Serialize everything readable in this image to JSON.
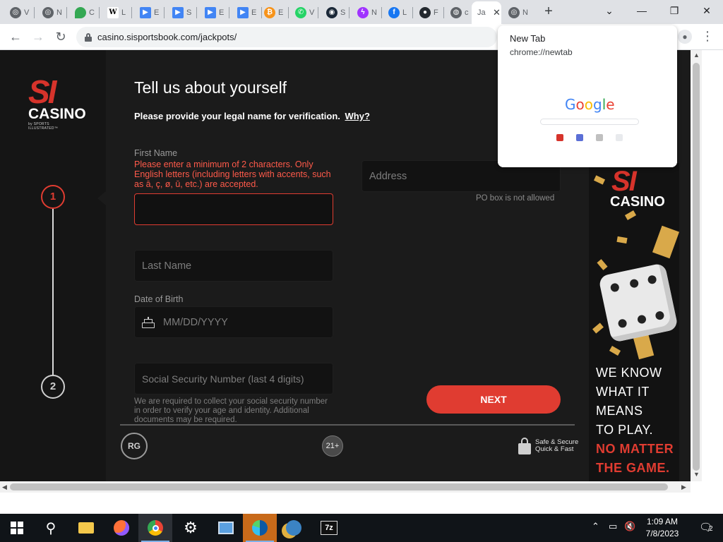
{
  "browser": {
    "tabs": [
      {
        "label": "V",
        "icon": "chrome-icon",
        "color": "#5f6368"
      },
      {
        "label": "N",
        "icon": "chrome-icon",
        "color": "#5f6368"
      },
      {
        "label": "C",
        "icon": "google-maps-icon",
        "color": "#34a853"
      },
      {
        "label": "L",
        "icon": "wikipedia-icon",
        "color": "#202124"
      },
      {
        "label": "E",
        "icon": "play-icon",
        "color": "#4285f4"
      },
      {
        "label": "S",
        "icon": "play-icon",
        "color": "#4285f4"
      },
      {
        "label": "E",
        "icon": "play-icon",
        "color": "#4285f4"
      },
      {
        "label": "E",
        "icon": "play-icon",
        "color": "#4285f4"
      },
      {
        "label": "E",
        "icon": "bitcoin-icon",
        "color": "#f7931a"
      },
      {
        "label": "V",
        "icon": "whatsapp-icon",
        "color": "#25d366"
      },
      {
        "label": "S",
        "icon": "steam-icon",
        "color": "#1b2838"
      },
      {
        "label": "N",
        "icon": "messenger-icon",
        "color": "#a033ff"
      },
      {
        "label": "L",
        "icon": "facebook-icon",
        "color": "#1877f2"
      },
      {
        "label": "F",
        "icon": "github-icon",
        "color": "#24292f"
      },
      {
        "label": "c",
        "icon": "globe-icon",
        "color": "#5f6368"
      },
      {
        "label": "Ja",
        "icon": "",
        "color": "#5f6368",
        "active": true
      },
      {
        "label": "N",
        "icon": "chrome-icon",
        "color": "#5f6368"
      }
    ],
    "new_tab": "+",
    "url": "casino.sisportsbook.com/jackpots/",
    "window_controls": [
      "⌄",
      "—",
      "❐",
      "✕"
    ]
  },
  "preview": {
    "title": "New Tab",
    "url": "chrome://newtab",
    "google": "Google"
  },
  "page": {
    "logo_si": "SI",
    "logo_casino": "CASINO",
    "logo_by": "by SPORTS ILLUSTRATED™",
    "steps": [
      "1",
      "2"
    ],
    "title": "Tell us about yourself",
    "subtitle": "Please provide your legal name for verification.",
    "why_link": "Why?",
    "first_name_label": "First Name",
    "first_name_error": "Please enter a minimum of 2 characters. Only English letters (including letters with accents, such as ā, ç, ø, ū, etc.) are accepted.",
    "first_name_value": "",
    "address_placeholder": "Address",
    "po_note": "PO box is not allowed",
    "last_name_placeholder": "Last Name",
    "dob_label": "Date of Birth",
    "dob_placeholder": "MM/DD/YYYY",
    "ssn_placeholder": "Social Security Number (last 4 digits)",
    "ssn_note": "We are required to collect your social security number in order to verify your age and identity. Additional documents may be required.",
    "next_button": "NEXT",
    "rg_badge": "RG",
    "age_badge": "21+",
    "secure_line1": "Safe & Secure",
    "secure_line2": "Quick & Fast"
  },
  "ad": {
    "si": "SI",
    "casino": "CASINO",
    "line1": "WE KNOW",
    "line2": "WHAT IT",
    "line3": "MEANS",
    "line4": "TO PLAY.",
    "line5": "NO MATTER",
    "line6": "THE GAME."
  },
  "taskbar": {
    "time": "1:09 AM",
    "date": "7/8/2023",
    "notifications": "2",
    "apps": [
      "start",
      "search",
      "file-explorer",
      "firefox",
      "chrome",
      "settings",
      "control-panel",
      "edge",
      "network-tool",
      "7zip"
    ]
  },
  "colors": {
    "accent": "#e03c31",
    "page_bg": "#1b1b1b"
  }
}
